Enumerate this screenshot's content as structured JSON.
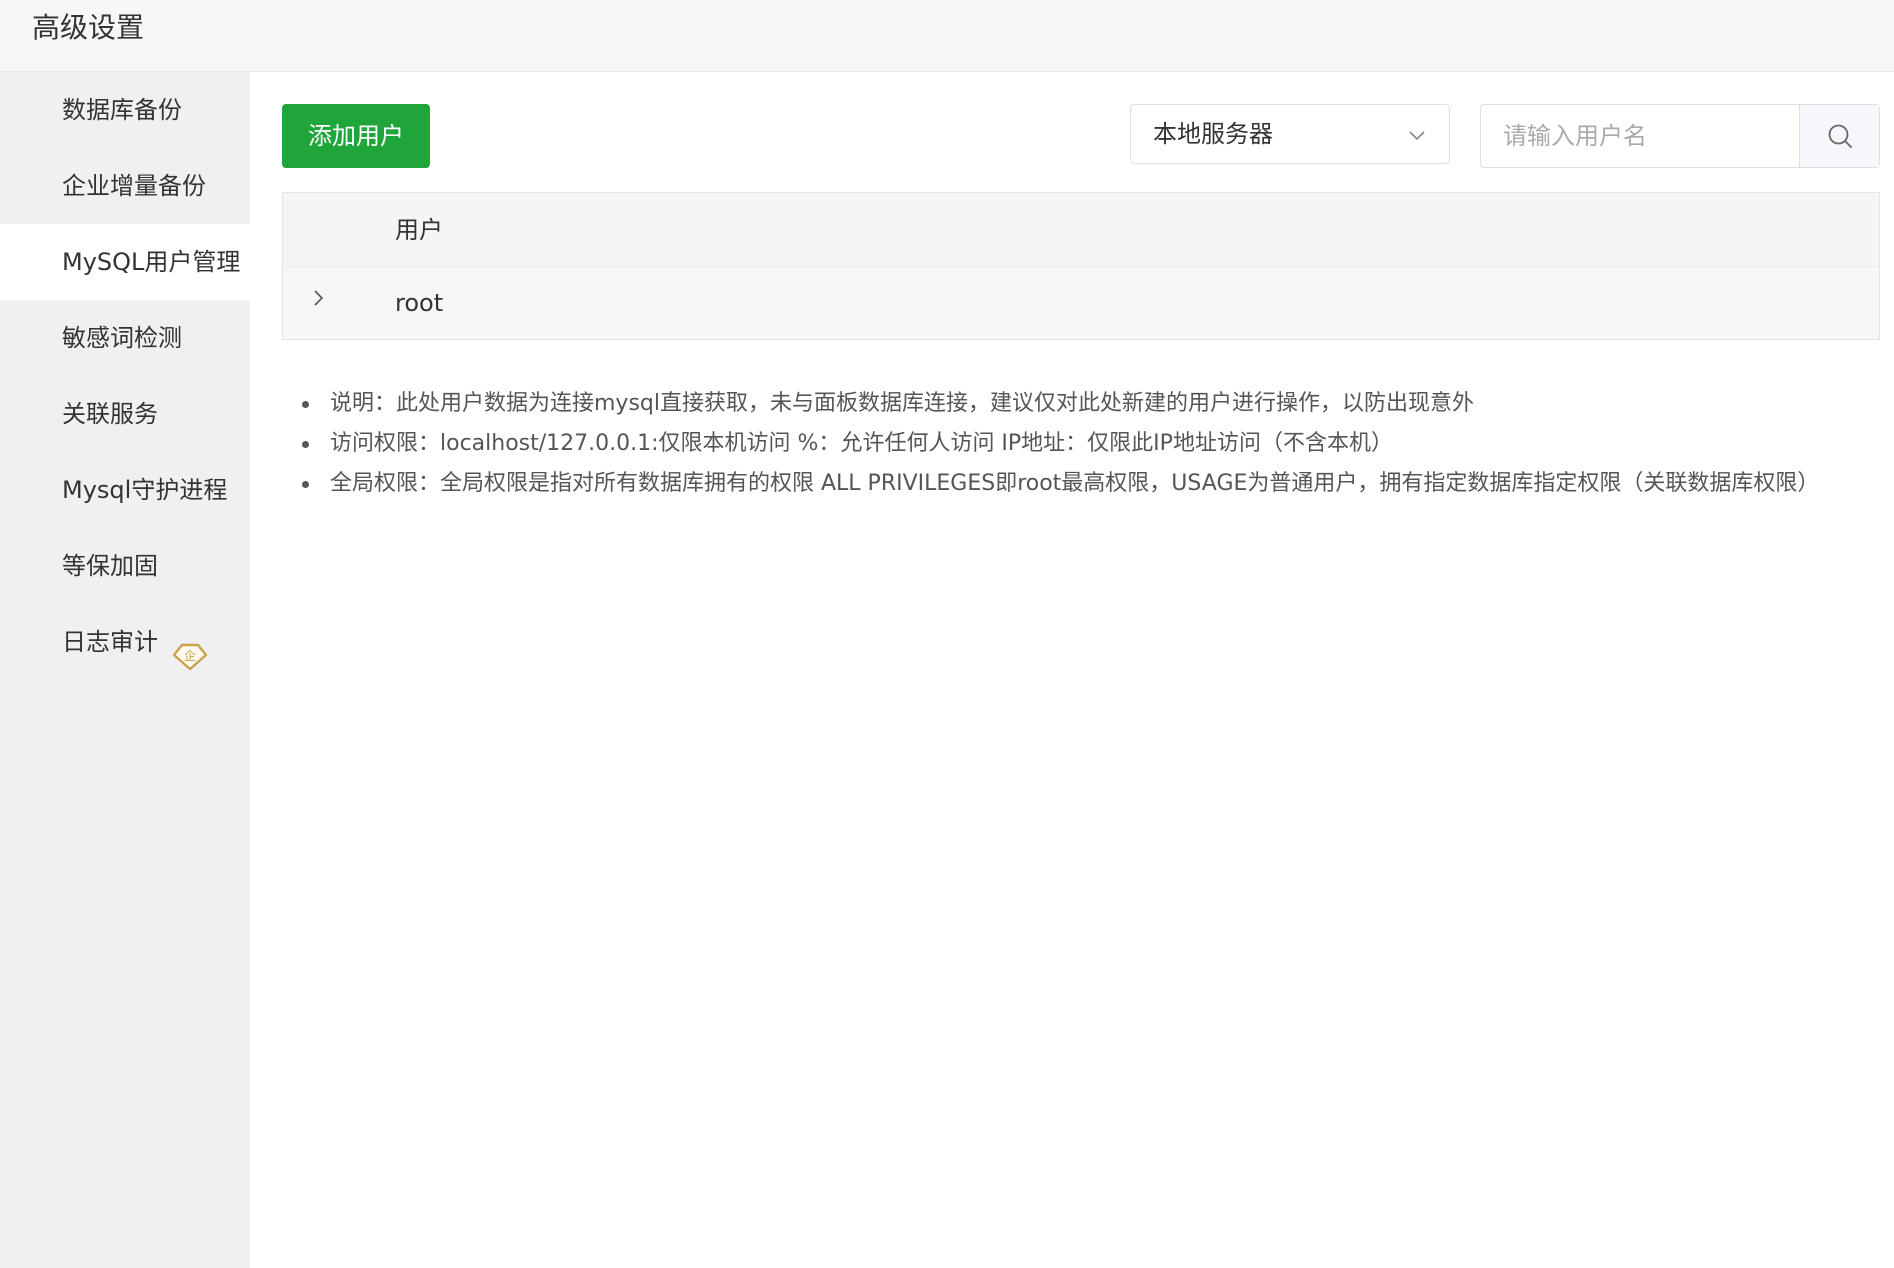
{
  "header": {
    "title": "高级设置"
  },
  "sidebar": {
    "items": [
      {
        "label": "数据库备份"
      },
      {
        "label": "企业增量备份"
      },
      {
        "label": "MySQL用户管理"
      },
      {
        "label": "敏感词检测"
      },
      {
        "label": "关联服务"
      },
      {
        "label": "Mysql守护进程"
      },
      {
        "label": "等保加固"
      },
      {
        "label": "日志审计",
        "badge": "企"
      }
    ],
    "active_index": 2
  },
  "toolbar": {
    "add_user_label": "添加用户",
    "server_select_value": "本地服务器",
    "search_placeholder": "请输入用户名"
  },
  "table": {
    "columns": [
      "用户"
    ],
    "rows": [
      {
        "user": "root"
      }
    ]
  },
  "notes": [
    "说明：此处用户数据为连接mysql直接获取，未与面板数据库连接，建议仅对此处新建的用户进行操作，以防出现意外",
    "访问权限：localhost/127.0.0.1:仅限本机访问 %：允许任何人访问 IP地址：仅限此IP地址访问（不含本机）",
    "全局权限：全局权限是指对所有数据库拥有的权限 ALL PRIVILEGES即root最高权限，USAGE为普通用户，拥有指定数据库指定权限（关联数据库权限）"
  ],
  "colors": {
    "accent": "#20a53a",
    "badge": "#c9a24b"
  }
}
